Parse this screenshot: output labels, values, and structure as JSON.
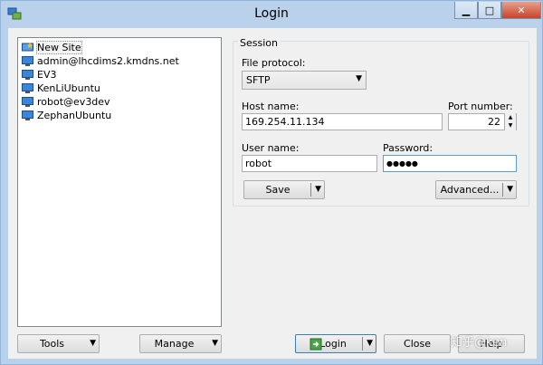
{
  "window": {
    "title": "Login",
    "app_icon": "winscp-icon"
  },
  "caption_buttons": {
    "minimize": "▁",
    "maximize": "□",
    "close": "✕"
  },
  "sites": [
    {
      "label": "New Site",
      "icon": "new-site-icon"
    },
    {
      "label": "admin@lhcdims2.kmdns.net",
      "icon": "monitor-icon"
    },
    {
      "label": "EV3",
      "icon": "monitor-icon"
    },
    {
      "label": "KenLiUbuntu",
      "icon": "monitor-icon"
    },
    {
      "label": "robot@ev3dev",
      "icon": "monitor-icon"
    },
    {
      "label": "ZephanUbuntu",
      "icon": "monitor-icon"
    }
  ],
  "session": {
    "group_title": "Session",
    "file_protocol_label": "File protocol:",
    "file_protocol_value": "SFTP",
    "host_name_label": "Host name:",
    "host_name_value": "169.254.11.134",
    "port_label": "Port number:",
    "port_value": "22",
    "user_name_label": "User name:",
    "user_name_value": "robot",
    "password_label": "Password:",
    "password_value": "●●●●●",
    "save_label": "Save",
    "advanced_label": "Advanced..."
  },
  "footer": {
    "tools_label": "Tools",
    "manage_label": "Manage",
    "login_label": "Login",
    "close_label": "Close",
    "help_label": "Help"
  },
  "watermark": "知乎@ken",
  "colors": {
    "frame": "#b9d1ea",
    "client": "#f0f0f0",
    "close_button": "#c7432a",
    "focus": "#569de5"
  }
}
